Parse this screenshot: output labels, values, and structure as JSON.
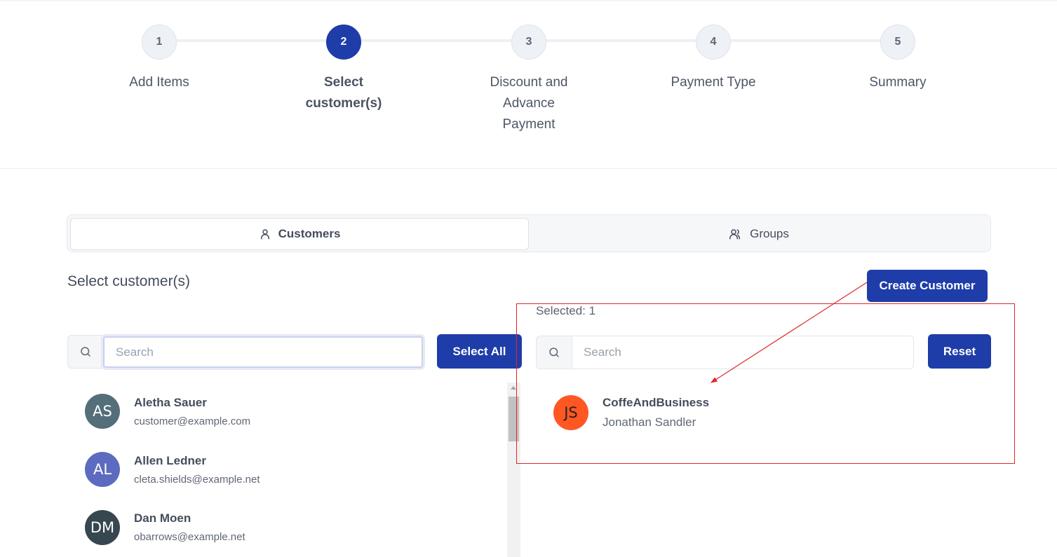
{
  "stepper": {
    "steps": [
      {
        "number": "1",
        "label": "Add Items"
      },
      {
        "number": "2",
        "label": "Select\ncustomer(s)"
      },
      {
        "number": "3",
        "label": "Discount and\nAdvance\nPayment"
      },
      {
        "number": "4",
        "label": "Payment Type"
      },
      {
        "number": "5",
        "label": "Summary"
      }
    ],
    "active_step": 2
  },
  "tabs": {
    "customers_label": "Customers",
    "groups_label": "Groups",
    "active": "Customers"
  },
  "page": {
    "section_title": "Select customer(s)",
    "create_button": "Create Customer"
  },
  "available": {
    "search_placeholder": "Search",
    "select_all_button": "Select All",
    "customers": [
      {
        "initials": "AS",
        "name": "Aletha Sauer",
        "email": "customer@example.com",
        "color": "#546e7a"
      },
      {
        "initials": "AL",
        "name": "Allen Ledner",
        "email": "cleta.shields@example.net",
        "color": "#5c6bc0"
      },
      {
        "initials": "DM",
        "name": "Dan Moen",
        "email": "obarrows@example.net",
        "color": "#37474f"
      }
    ]
  },
  "selected": {
    "count_label": "Selected: 1",
    "search_placeholder": "Search",
    "reset_button": "Reset",
    "customers": [
      {
        "initials": "JS",
        "name": "CoffeAndBusiness",
        "subtitle": "Jonathan Sandler",
        "color": "#ff5722"
      }
    ]
  },
  "colors": {
    "primary": "#1e3da8",
    "annotation": "#e0262a"
  }
}
